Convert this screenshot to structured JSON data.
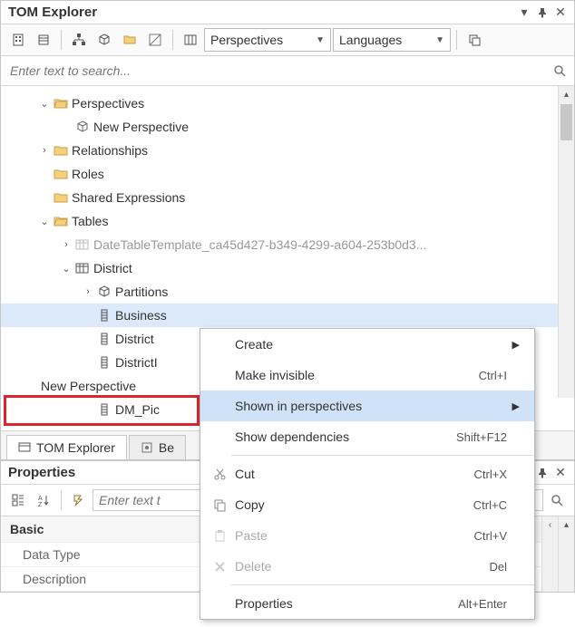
{
  "panel": {
    "title": "TOM Explorer",
    "toolbar": {
      "perspectives_combo": "Perspectives",
      "languages_combo": "Languages"
    },
    "search_placeholder": "Enter text to search..."
  },
  "tree": {
    "perspectives": {
      "label": "Perspectives",
      "expanded": true
    },
    "new_perspective": {
      "label": "New Perspective"
    },
    "relationships": {
      "label": "Relationships",
      "expanded": false
    },
    "roles": {
      "label": "Roles"
    },
    "shared_expressions": {
      "label": "Shared Expressions"
    },
    "tables": {
      "label": "Tables",
      "expanded": true
    },
    "date_template": {
      "label": "DateTableTemplate_ca45d427-b349-4299-a604-253b0d3..."
    },
    "district": {
      "label": "District",
      "expanded": true
    },
    "partitions": {
      "label": "Partitions",
      "expanded": false
    },
    "business_col": {
      "label": "Business"
    },
    "district_col": {
      "label": "District"
    },
    "districtl_col": {
      "label": "DistrictI"
    },
    "dm_pic_col": {
      "label": "DM_Pic"
    }
  },
  "perspective_marker": {
    "label": "New Perspective"
  },
  "tabs": {
    "tom_explorer": "TOM Explorer",
    "be_tab": "Be"
  },
  "properties": {
    "title": "Properties",
    "search_placeholder": "Enter text t",
    "category": "Basic",
    "rows": {
      "data_type": "Data Type",
      "description": "Description"
    }
  },
  "context_menu": {
    "create": {
      "label": "Create"
    },
    "make_invisible": {
      "label": "Make invisible",
      "shortcut": "Ctrl+I"
    },
    "shown_in_perspectives": {
      "label": "Shown in perspectives"
    },
    "show_dependencies": {
      "label": "Show dependencies",
      "shortcut": "Shift+F12"
    },
    "cut": {
      "label": "Cut",
      "shortcut": "Ctrl+X"
    },
    "copy": {
      "label": "Copy",
      "shortcut": "Ctrl+C"
    },
    "paste": {
      "label": "Paste",
      "shortcut": "Ctrl+V"
    },
    "delete": {
      "label": "Delete",
      "shortcut": "Del"
    },
    "properties": {
      "label": "Properties",
      "shortcut": "Alt+Enter"
    }
  }
}
